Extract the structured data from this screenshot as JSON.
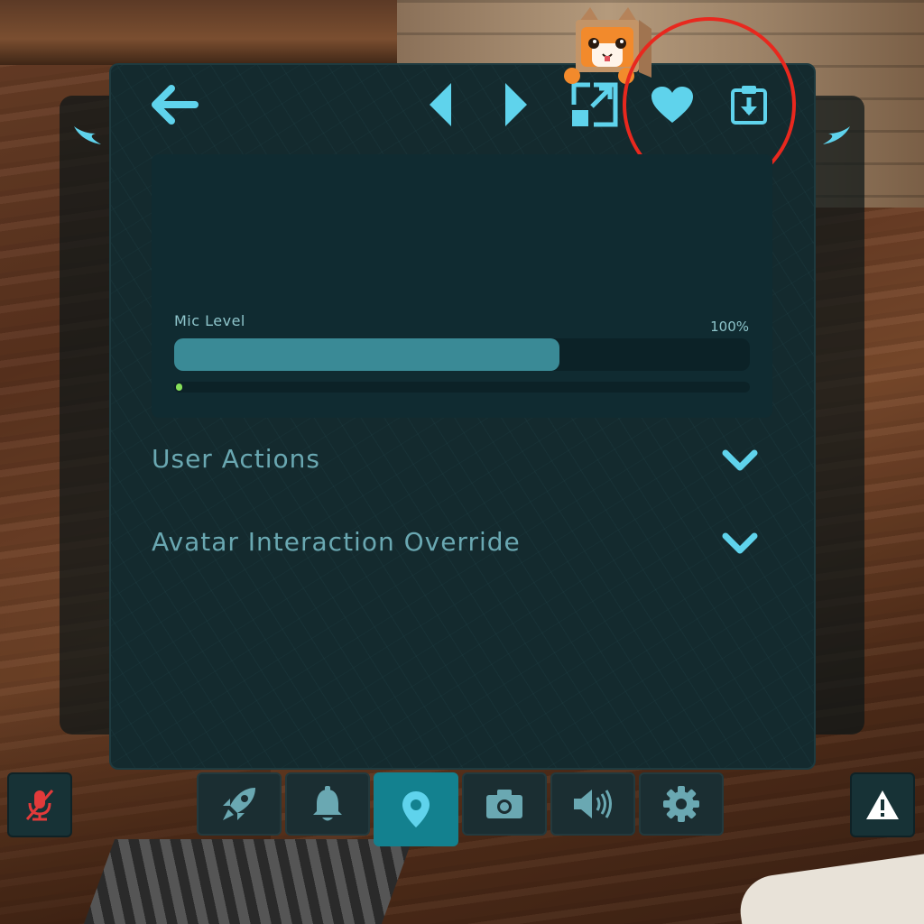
{
  "colors": {
    "accent": "#5fd3ec",
    "panel": "#142a2e",
    "active_tab": "#13818f",
    "mute": "#e23a3a",
    "highlight": "#e8281e",
    "meter": "#86e05a"
  },
  "toolbar": {
    "icons": [
      "arrow-left-icon",
      "triangle-left-icon",
      "triangle-right-icon",
      "expand-icon",
      "heart-icon",
      "download-icon"
    ]
  },
  "mic": {
    "label": "Mic Level",
    "value_text": "100%",
    "slider_fraction": 0.67,
    "meter_fraction": 0.01
  },
  "sections": [
    {
      "label": "User Actions"
    },
    {
      "label": "Avatar Interaction Override"
    }
  ],
  "bottom_bar": {
    "tabs": [
      {
        "icon": "rocket-icon",
        "active": false
      },
      {
        "icon": "bell-icon",
        "active": false
      },
      {
        "icon": "location-pin-icon",
        "active": true
      },
      {
        "icon": "camera-icon",
        "active": false
      },
      {
        "icon": "speaker-icon",
        "active": false
      },
      {
        "icon": "gear-icon",
        "active": false
      }
    ],
    "left_button_icon": "mic-muted-icon",
    "right_button_icon": "warning-icon"
  }
}
